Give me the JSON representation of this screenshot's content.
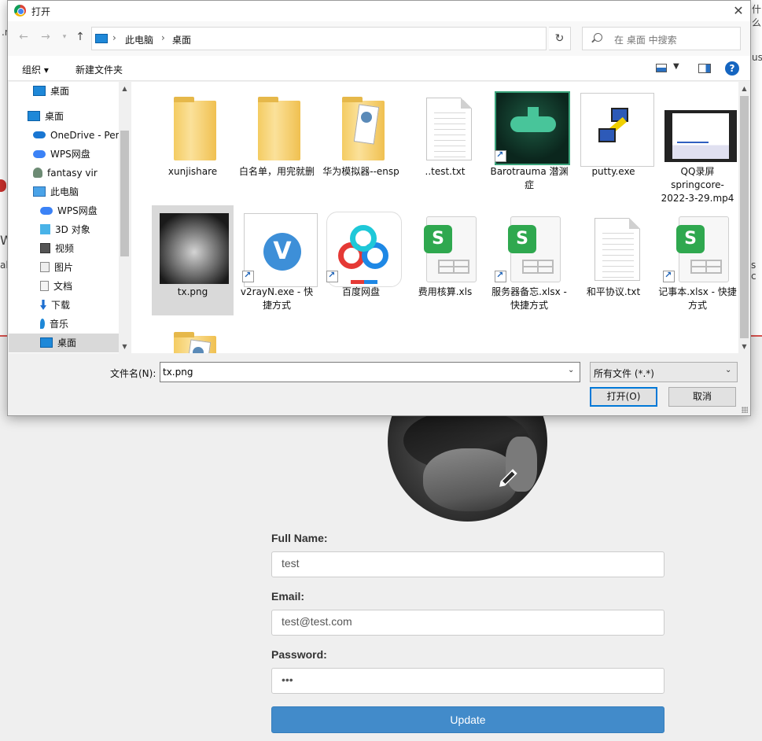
{
  "dialog": {
    "title": "打开",
    "breadcrumb": [
      "此电脑",
      "桌面"
    ],
    "search_placeholder": "在 桌面 中搜索",
    "toolbar": {
      "organize": "组织 ▾",
      "new_folder": "新建文件夹"
    },
    "sidebar": [
      {
        "label": "桌面",
        "icon": "desktop-icon",
        "indent": 2,
        "selected": false
      },
      {
        "label": "桌面",
        "icon": "desktop-icon",
        "indent": 1,
        "selected": false
      },
      {
        "label": "OneDrive - Per",
        "icon": "cloud-icon",
        "indent": 2,
        "selected": false
      },
      {
        "label": "WPS网盘",
        "icon": "wps-cloud-icon",
        "indent": 2,
        "selected": false
      },
      {
        "label": "fantasy vir",
        "icon": "user-icon",
        "indent": 2,
        "selected": false
      },
      {
        "label": "此电脑",
        "icon": "pc-icon",
        "indent": 2,
        "selected": false
      },
      {
        "label": "WPS网盘",
        "icon": "wps-cloud-icon",
        "indent": 3,
        "selected": false
      },
      {
        "label": "3D 对象",
        "icon": "3d-objects-icon",
        "indent": 3,
        "selected": false
      },
      {
        "label": "视频",
        "icon": "video-folder-icon",
        "indent": 3,
        "selected": false
      },
      {
        "label": "图片",
        "icon": "picture-folder-icon",
        "indent": 3,
        "selected": false
      },
      {
        "label": "文档",
        "icon": "document-folder-icon",
        "indent": 3,
        "selected": false
      },
      {
        "label": "下载",
        "icon": "download-icon",
        "indent": 3,
        "selected": false
      },
      {
        "label": "音乐",
        "icon": "music-icon",
        "indent": 3,
        "selected": false
      },
      {
        "label": "桌面",
        "icon": "desktop-icon",
        "indent": 3,
        "selected": true
      }
    ],
    "files": [
      {
        "name": "xunjishare",
        "kind": "folder",
        "shortcut": false
      },
      {
        "name": "白名单，用完就删",
        "kind": "folder",
        "shortcut": false
      },
      {
        "name": "华为模拟器--ensp",
        "kind": "folder-doc",
        "shortcut": false
      },
      {
        "name": "..test.txt",
        "kind": "text",
        "shortcut": false
      },
      {
        "name": "Barotrauma 潜渊症",
        "kind": "barotrauma",
        "shortcut": true
      },
      {
        "name": "putty.exe",
        "kind": "putty",
        "shortcut": false
      },
      {
        "name": "QQ录屏springcore-2022-3-29.mp4",
        "kind": "video",
        "shortcut": false
      },
      {
        "name": "tx.png",
        "kind": "photo",
        "shortcut": false,
        "selected": true
      },
      {
        "name": "v2rayN.exe - 快捷方式",
        "kind": "v2ray",
        "shortcut": true
      },
      {
        "name": "百度网盘",
        "kind": "baidu",
        "shortcut": true
      },
      {
        "name": "费用核算.xls",
        "kind": "xls",
        "shortcut": false
      },
      {
        "name": "服务器备忘.xlsx - 快捷方式",
        "kind": "xls",
        "shortcut": true
      },
      {
        "name": "和平协议.txt",
        "kind": "text",
        "shortcut": false
      },
      {
        "name": "记事本.xlsx - 快捷方式",
        "kind": "xls",
        "shortcut": true
      },
      {
        "name": "",
        "kind": "folder-doc",
        "shortcut": false
      }
    ],
    "filename_label": "文件名(N):",
    "filename_value": "tx.png",
    "filetype_value": "所有文件 (*.*)",
    "open_button": "打开(O)",
    "cancel_button": "取消"
  },
  "page": {
    "full_name_label": "Full Name:",
    "full_name_value": "test",
    "email_label": "Email:",
    "email_value": "test@test.com",
    "password_label": "Password:",
    "password_value": "•••",
    "update_button": "Update",
    "fragments": {
      "a": ".n",
      "b": "us",
      "c": "W",
      "d": "al",
      "e": "s c",
      "f": "什么"
    }
  },
  "colors": {
    "accent": "#428bca",
    "selection": "#d9d9d9",
    "dialog_bg": "#f0f0f0",
    "danger": "#d9534f"
  }
}
